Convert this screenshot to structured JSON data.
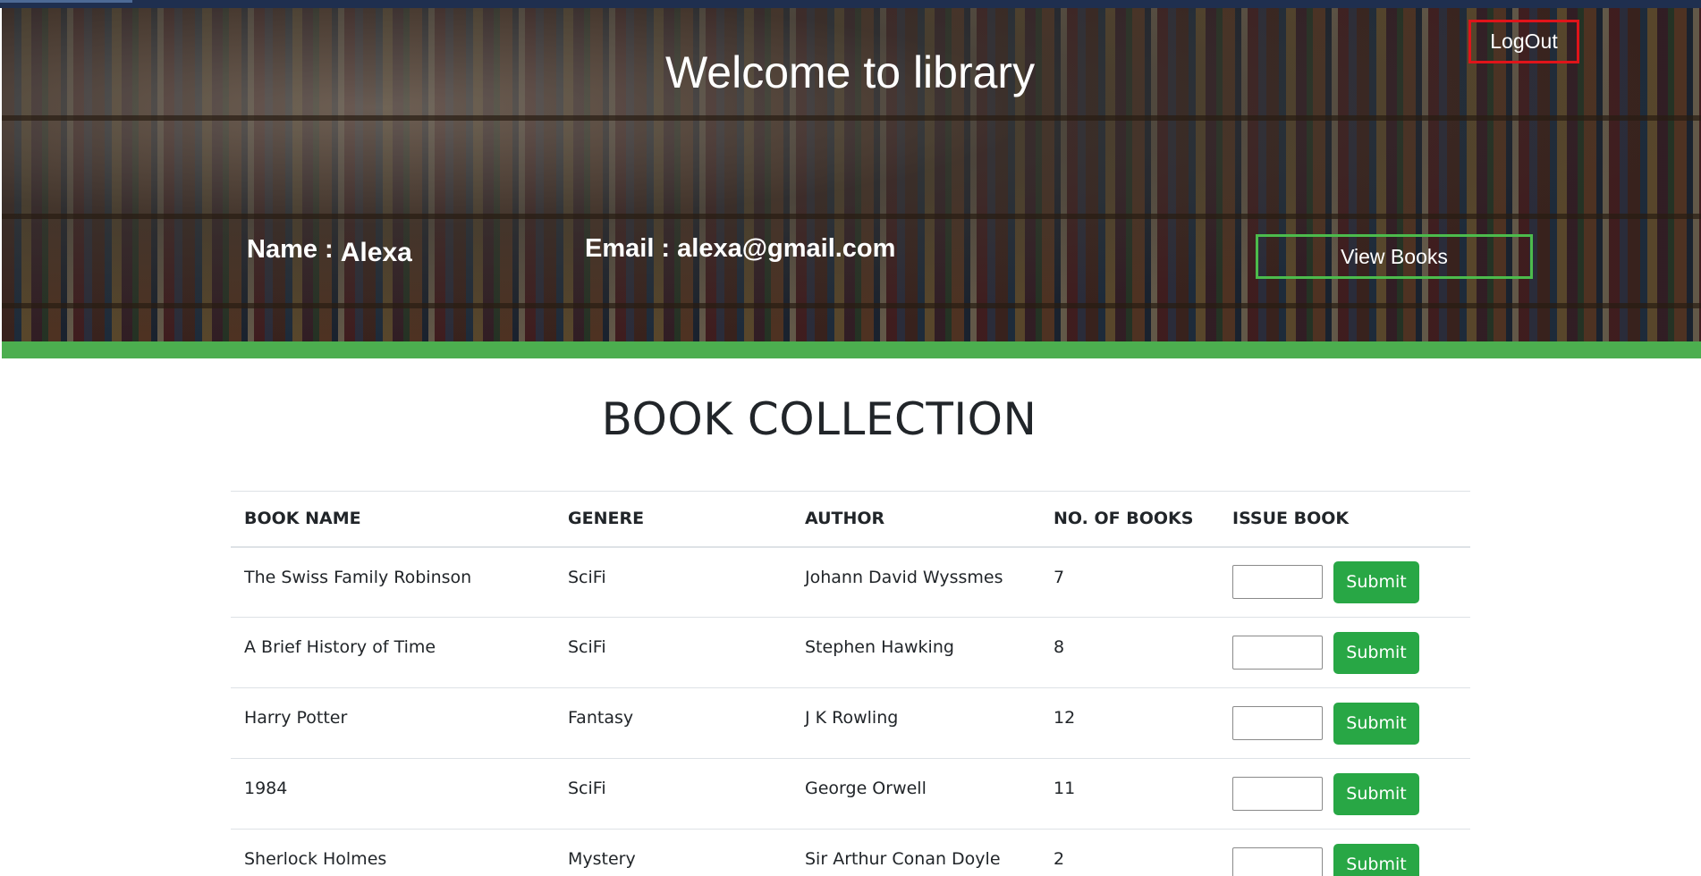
{
  "header": {
    "title": "Welcome to library",
    "logout_label": "LogOut",
    "name_label": "Name : ",
    "name_value": "Alexa",
    "email_label": "Email : ",
    "email_value": "alexa@gmail.com",
    "view_books_label": "View Books"
  },
  "colors": {
    "accent_green": "#4cae4f",
    "submit_green": "#28a745",
    "logout_border": "#e0141a"
  },
  "collection": {
    "title": "BOOK COLLECTION",
    "columns": [
      "BOOK NAME",
      "GENERE",
      "AUTHOR",
      "NO. OF BOOKS",
      "ISSUE BOOK"
    ],
    "submit_label": "Submit",
    "rows": [
      {
        "name": "The Swiss Family Robinson",
        "genre": "SciFi",
        "author": "Johann David Wyssmes",
        "count": "7"
      },
      {
        "name": "A Brief History of Time",
        "genre": "SciFi",
        "author": "Stephen Hawking",
        "count": "8"
      },
      {
        "name": "Harry Potter",
        "genre": "Fantasy",
        "author": "J K Rowling",
        "count": "12"
      },
      {
        "name": "1984",
        "genre": "SciFi",
        "author": "George Orwell",
        "count": "11"
      },
      {
        "name": "Sherlock Holmes",
        "genre": "Mystery",
        "author": "Sir Arthur Conan Doyle",
        "count": "2"
      }
    ]
  }
}
